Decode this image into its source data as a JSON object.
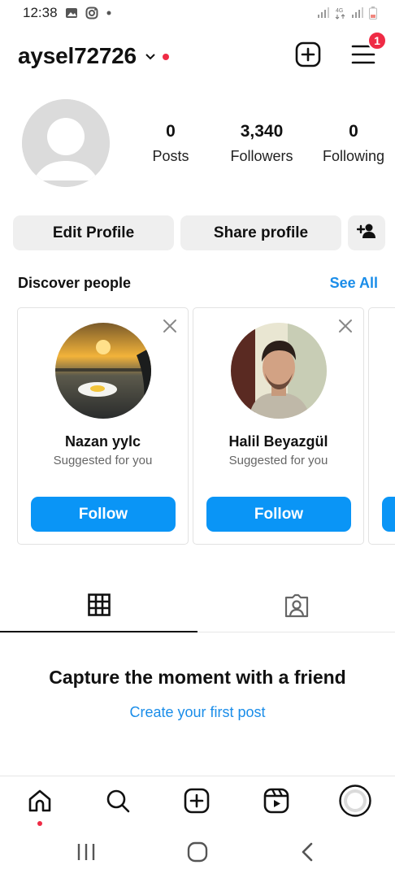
{
  "status_bar": {
    "time": "12:38",
    "left_icons": [
      "gallery-icon",
      "instagram-icon",
      "dot-icon"
    ],
    "right_icons": [
      "signal-icon",
      "4g-icon",
      "signal-icon",
      "battery-icon"
    ]
  },
  "header": {
    "username": "aysel72726",
    "notification_count": "1",
    "icons": [
      "chevron-down-icon",
      "new-post-icon",
      "menu-icon"
    ],
    "accent_red": "#ef2b45"
  },
  "profile": {
    "stats": [
      {
        "value": "0",
        "label": "Posts"
      },
      {
        "value": "3,340",
        "label": "Followers"
      },
      {
        "value": "0",
        "label": "Following"
      }
    ]
  },
  "actions": {
    "edit_label": "Edit Profile",
    "share_label": "Share profile",
    "discover_icon": "add-person-icon"
  },
  "discover": {
    "title": "Discover people",
    "see_all": "See All",
    "cards": [
      {
        "name": "Nazan yylc",
        "subtitle": "Suggested for you",
        "button": "Follow"
      },
      {
        "name": "Halil Beyazgül",
        "subtitle": "Suggested for you",
        "button": "Follow"
      }
    ],
    "follow_color": "#0a95f6"
  },
  "tabs": [
    "grid-icon",
    "tagged-icon"
  ],
  "empty_state": {
    "title": "Capture the moment with a friend",
    "link": "Create your first post"
  },
  "bottom_nav": [
    "home-icon",
    "search-icon",
    "create-icon",
    "reels-icon",
    "profile-icon"
  ],
  "system_nav": [
    "recent-apps-icon",
    "home-circle-icon",
    "back-icon"
  ]
}
